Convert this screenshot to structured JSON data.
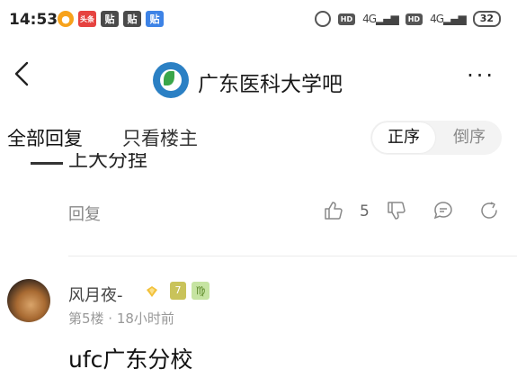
{
  "status_bar": {
    "time": "14:53",
    "icons": [
      "weibo-icon",
      "toutiao-icon",
      "tieba-icon",
      "tieba-icon",
      "tieba-blue-icon"
    ],
    "app_labels": [
      "头条",
      "贴",
      "贴",
      "贴"
    ],
    "network": [
      "HD",
      "4G",
      "HD",
      "4G"
    ],
    "battery": "32"
  },
  "nav": {
    "title": "广东医科大学吧"
  },
  "tabs": {
    "all_replies": "全部回复",
    "only_op": "只看楼主",
    "sort_asc": "正序",
    "sort_desc": "倒序"
  },
  "prev_post": {
    "cut_text": "上大分捏",
    "reply_label": "回复",
    "like_count": "5"
  },
  "post": {
    "username": "风月夜-",
    "level": "7",
    "floor_time": "第5楼 · 18小时前",
    "content": "ufc广东分校"
  },
  "colors": {
    "accent_blue": "#2b80c4",
    "muted_text": "#999999"
  }
}
